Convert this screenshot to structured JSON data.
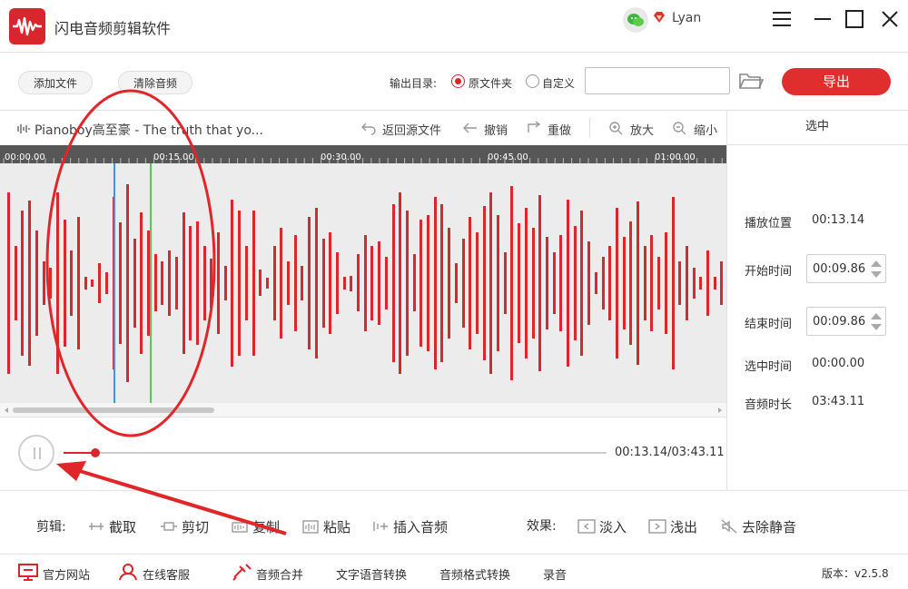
{
  "app": {
    "title": "闪电音频剪辑软件",
    "user": "Lyan"
  },
  "toolbar": {
    "add_file": "添加文件",
    "clear_audio": "清除音频",
    "output_dir_label": "输出目录:",
    "radio_original": "原文件夹",
    "radio_custom": "自定义",
    "selected_output": "原文件夹",
    "path_value": "",
    "export_label": "导出"
  },
  "editor": {
    "track_name": "Pianoboy高至豪 - The truth that yo...",
    "back_to_source": "返回源文件",
    "undo": "撤销",
    "redo": "重做",
    "zoom_in": "放大",
    "zoom_out": "缩小",
    "ruler_ticks": [
      "00:00.00",
      "00:15.00",
      "00:30.00",
      "00:45.00",
      "01:00.00"
    ]
  },
  "playback": {
    "time_display": "00:13.14/03:43.11",
    "progress_fraction": 0.059
  },
  "panel": {
    "title": "选中",
    "play_pos_label": "播放位置",
    "play_pos_value": "00:13.14",
    "start_label": "开始时间",
    "start_value": "00:09.86",
    "end_label": "结束时间",
    "end_value": "00:09.86",
    "sel_label": "选中时间",
    "sel_value": "00:00.00",
    "dur_label": "音频时长",
    "dur_value": "03:43.11"
  },
  "clip": {
    "label": "剪辑:",
    "cut": "截取",
    "trim": "剪切",
    "copy": "复制",
    "paste": "粘贴",
    "insert": "插入音频"
  },
  "effects": {
    "label": "效果:",
    "fade_in": "淡入",
    "fade_out": "浅出",
    "remove_silence": "去除静音"
  },
  "bottom": {
    "website": "官方网站",
    "support": "在线客服",
    "merge": "音频合并",
    "tts": "文字语音转换",
    "convert": "音频格式转换",
    "record": "录音",
    "version": "版本：v2.5.8"
  },
  "colors": {
    "accent": "#d9262c",
    "waveform": "#d7282e",
    "marker_blue": "#3a9ad9",
    "marker_green": "#59c55b"
  }
}
